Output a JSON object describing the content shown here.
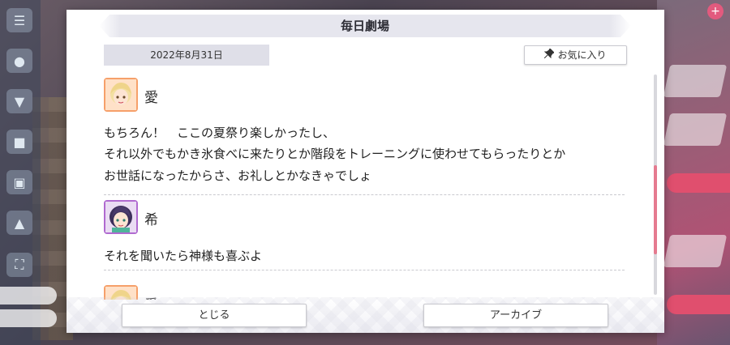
{
  "modal": {
    "title": "毎日劇場",
    "date": "2022年8月31日",
    "favorite_label": "お気に入り",
    "close_label": "とじる",
    "archive_label": "アーカイブ"
  },
  "entries": [
    {
      "speaker": "愛",
      "lines": [
        "もちろん！　ここの夏祭り楽しかったし、",
        "それ以外でもかき氷食べに来たりとか階段をトレーニングに使わせてもらったりとか",
        "お世話になったからさ、お礼しとかなきゃでしょ"
      ]
    },
    {
      "speaker": "希",
      "lines": [
        "それを聞いたら神様も喜ぶよ"
      ]
    },
    {
      "speaker": "愛",
      "lines": []
    }
  ],
  "colors": {
    "scroll_thumb": "#e57a8f",
    "accent_pink": "#e04f6e"
  },
  "icons": {
    "favorite": "pin-icon"
  },
  "scroll": {
    "position_fraction": 0.5
  }
}
